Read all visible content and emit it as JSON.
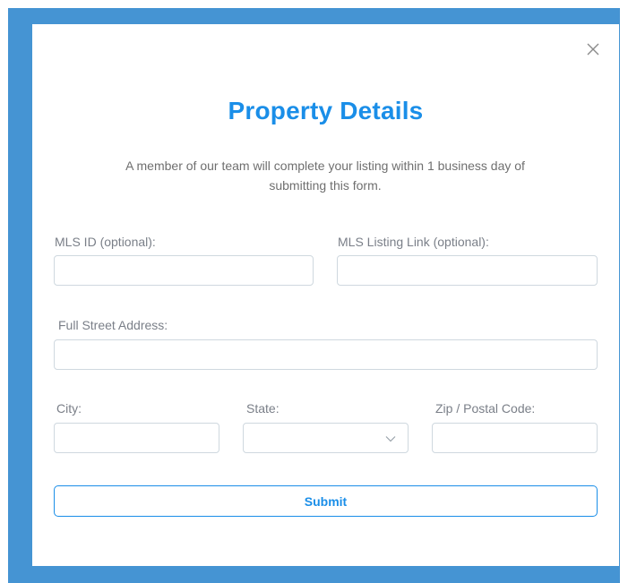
{
  "modal": {
    "title": "Property Details",
    "subtitle": "A member of our team will complete your listing within 1 business day of submitting this form.",
    "close_icon": "close-icon"
  },
  "fields": {
    "mls_id": {
      "label": "MLS ID (optional):",
      "value": "",
      "placeholder": ""
    },
    "mls_listing_link": {
      "label": "MLS Listing Link (optional):",
      "value": "",
      "placeholder": ""
    },
    "full_street_address": {
      "label": "Full Street Address:",
      "value": "",
      "placeholder": ""
    },
    "city": {
      "label": "City:",
      "value": "",
      "placeholder": ""
    },
    "state": {
      "label": "State:",
      "selected": "",
      "chevron_icon": "chevron-down-icon"
    },
    "zip": {
      "label": "Zip / Postal Code:",
      "value": "",
      "placeholder": ""
    }
  },
  "actions": {
    "submit_label": "Submit"
  },
  "colors": {
    "frame": "#4594d3",
    "accent": "#1a8ee8",
    "field_border": "#cfd8df",
    "label_text": "#7a7f88",
    "body_text": "#6f6f6f"
  }
}
